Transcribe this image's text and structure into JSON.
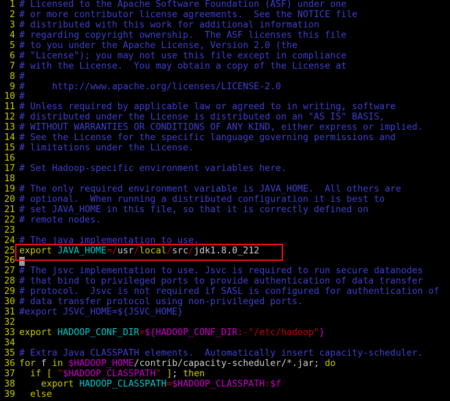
{
  "editor": {
    "background_color": "#000000",
    "gutter_color": "#cdcd00",
    "comment_color": "#4040d0",
    "keyword_color": "#cdcd00",
    "variable_color": "#00cdcd",
    "expansion_color": "#cd00cd",
    "operator_color": "#cd0000",
    "text_color": "#d0d0d0",
    "annotation_color": "#ee1111",
    "annotation_target_line": "25",
    "cursor_line": "26"
  },
  "lines": [
    {
      "n": "1",
      "t": "# Licensed to the Apache Software Foundation (ASF) under one"
    },
    {
      "n": "2",
      "t": "# or more contributor license agreements.  See the NOTICE file"
    },
    {
      "n": "3",
      "t": "# distributed with this work for additional information"
    },
    {
      "n": "4",
      "t": "# regarding copyright ownership.  The ASF licenses this file"
    },
    {
      "n": "5",
      "t": "# to you under the Apache License, Version 2.0 (the"
    },
    {
      "n": "6",
      "t": "# \"License\"); you may not use this file except in compliance"
    },
    {
      "n": "7",
      "t": "# with the License.  You may obtain a copy of the License at"
    },
    {
      "n": "8",
      "t": "#"
    },
    {
      "n": "9",
      "t": "#     http://www.apache.org/licenses/LICENSE-2.0"
    },
    {
      "n": "10",
      "t": "#"
    },
    {
      "n": "11",
      "t": "# Unless required by applicable law or agreed to in writing, software"
    },
    {
      "n": "12",
      "t": "# distributed under the License is distributed on an \"AS IS\" BASIS,"
    },
    {
      "n": "13",
      "t": "# WITHOUT WARRANTIES OR CONDITIONS OF ANY KIND, either express or implied."
    },
    {
      "n": "14",
      "t": "# See the License for the specific language governing permissions and"
    },
    {
      "n": "15",
      "t": "# limitations under the License."
    },
    {
      "n": "16",
      "t": ""
    },
    {
      "n": "17",
      "t": "# Set Hadoop-specific environment variables here."
    },
    {
      "n": "18",
      "t": ""
    },
    {
      "n": "19",
      "t": "# The only required environment variable is JAVA_HOME.  All others are"
    },
    {
      "n": "20",
      "t": "# optional.  When running a distributed configuration it is best to"
    },
    {
      "n": "21",
      "t": "# set JAVA_HOME in this file, so that it is correctly defined on"
    },
    {
      "n": "22",
      "t": "# remote nodes."
    },
    {
      "n": "23",
      "t": ""
    },
    {
      "n": "24",
      "t": "# The java implementation to use."
    },
    {
      "n": "25",
      "t": "export JAVA_HOME=/usr/local/src/jdk1.8.0_212"
    },
    {
      "n": "26",
      "t": ""
    },
    {
      "n": "27",
      "t": "# The jsvc implementation to use. Jsvc is required to run secure datanodes"
    },
    {
      "n": "28",
      "t": "# that bind to privileged ports to provide authentication of data transfer"
    },
    {
      "n": "29",
      "t": "# protocol.  Jsvc is not required if SASL is configured for authentication of"
    },
    {
      "n": "30",
      "t": "# data transfer protocol using non-privileged ports."
    },
    {
      "n": "31",
      "t": "#export JSVC_HOME=${JSVC_HOME}"
    },
    {
      "n": "32",
      "t": ""
    },
    {
      "n": "33",
      "t": "export HADOOP_CONF_DIR=${HADOOP_CONF_DIR:-\"/etc/hadoop\"}"
    },
    {
      "n": "34",
      "t": ""
    },
    {
      "n": "35",
      "t": "# Extra Java CLASSPATH elements.  Automatically insert capacity-scheduler."
    },
    {
      "n": "36",
      "t": "for f in $HADOOP_HOME/contrib/capacity-scheduler/*.jar; do"
    },
    {
      "n": "37",
      "t": "  if [ \"$HADOOP_CLASSPATH\" ]; then"
    },
    {
      "n": "38",
      "t": "    export HADOOP_CLASSPATH=$HADOOP_CLASSPATH:$f"
    },
    {
      "n": "39",
      "t": "  else"
    }
  ],
  "tokens": {
    "l25": {
      "kw_export": "export",
      "var_name": "JAVA_HOME",
      "eq": "=",
      "slash": "/",
      "seg_usr": "usr",
      "seg_local": "local",
      "seg_src": "src",
      "seg_jdk": "jdk1.8.0_212"
    },
    "l33": {
      "kw_export": "export",
      "var_name": "HADOOP_CONF_DIR",
      "eq": "=",
      "dollar_brace": "${",
      "inner_var": "HADOOP_CONF_DIR",
      "colon_dash": ":-",
      "quote": "\"",
      "path": "/etc/hadoop",
      "close_brace": "}"
    },
    "l36": {
      "kw_for": "for",
      "f": " f ",
      "kw_in": "in",
      "dvar": "$HADOOP_HOME",
      "path": "/contrib/capacity-scheduler/*.jar;",
      "kw_do": "do"
    },
    "l37": {
      "kw_if": "if",
      "lbrack": "[",
      "quote": "\"",
      "dvar": "$HADOOP_CLASSPATH",
      "rbrack": "]",
      "semi": ";",
      "kw_then": "then"
    },
    "l38": {
      "kw_export": "export",
      "var_name": "HADOOP_CLASSPATH",
      "eq": "=",
      "dvar": "$HADOOP_CLASSPATH",
      "colon": ":",
      "dvar2": "$f"
    },
    "l39": {
      "kw_else": "else"
    },
    "l31": {
      "comment": "#export JSVC_HOME=${JSVC_HOME}"
    }
  }
}
